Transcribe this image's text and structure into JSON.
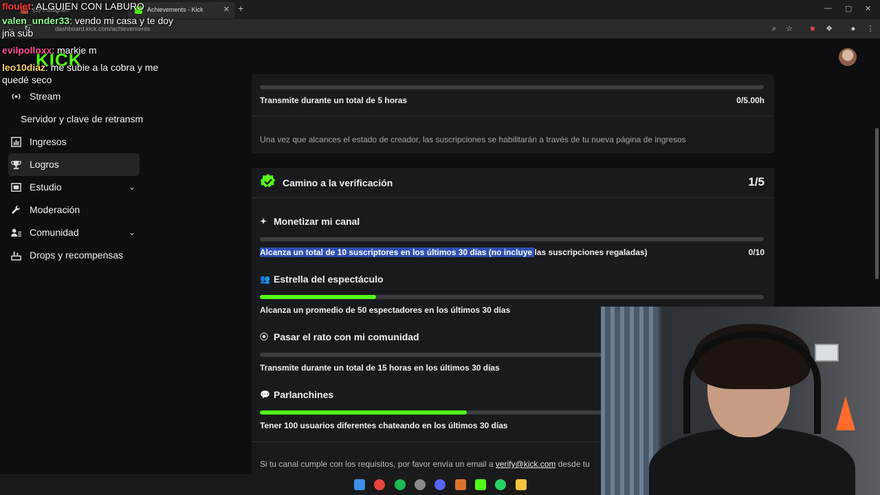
{
  "browser": {
    "tabs": [
      {
        "label": "(3) Instagram"
      },
      {
        "label": "Achievements - Kick Dashboard"
      }
    ],
    "url": "dashboard.kick.com/achievements"
  },
  "logo": "KICK",
  "nav": {
    "items": [
      {
        "label": "Stream"
      },
      {
        "label": "Servidor y clave de retransm"
      },
      {
        "label": "Ingresos"
      },
      {
        "label": "Logros"
      },
      {
        "label": "Estudio"
      },
      {
        "label": "Moderación"
      },
      {
        "label": "Comunidad"
      },
      {
        "label": "Drops y recompensas"
      }
    ]
  },
  "card1": {
    "requirement": "Transmite durante un total de 5 horas",
    "value": "0/5.00h",
    "progress": 0,
    "note": "Una vez que alcances el estado de creador, las suscripciones se habilitarán a través de tu nueva página de ingresos"
  },
  "card2": {
    "title": "Camino a la verificación",
    "count": "1/5",
    "tasks": [
      {
        "title": "Monetizar mi canal",
        "icon": "sparkle-icon",
        "requirement_highlighted": "Alcanza un total de 10 suscriptores en los últimos 30 días (no incluye ",
        "requirement_rest": "las suscripciones regaladas)",
        "value": "0/10",
        "progress": 0
      },
      {
        "title": "Estrella del espectáculo",
        "icon": "users-icon",
        "requirement": "Alcanza un promedio de 50 espectadores en los últimos 30 días",
        "progress": 0.23
      },
      {
        "title": "Pasar el rato con mi comunidad",
        "icon": "broadcast-icon",
        "requirement": "Transmite durante un total de 15 horas en los últimos 30 días",
        "progress": 0
      },
      {
        "title": "Parlanchines",
        "icon": "chat-bubble-icon",
        "requirement": "Tener 100 usuarios diferentes chateando en los últimos 30 días",
        "progress": 0.41
      }
    ],
    "footer_prefix": "Si tu canal cumple con los requisitos, por favor envía un email a ",
    "footer_email": "verify@kick.com",
    "footer_suffix": " desde tu"
  },
  "chat": [
    {
      "user": "floulet",
      "message": ": ALGUIEN CON LABURO"
    },
    {
      "user": "valen_under33",
      "message": ": vendo mi casa y te doy jna sub"
    },
    {
      "user": "evilpolloxx",
      "message": ": markie m"
    },
    {
      "user": "leo10diaz",
      "message": ": me subie a la cobra y me quedé seco"
    }
  ],
  "colors": {
    "accent": "#53fc18",
    "card_bg": "#191a1d",
    "page_bg": "#0d0e10",
    "highlight": "#2f4fb3"
  }
}
